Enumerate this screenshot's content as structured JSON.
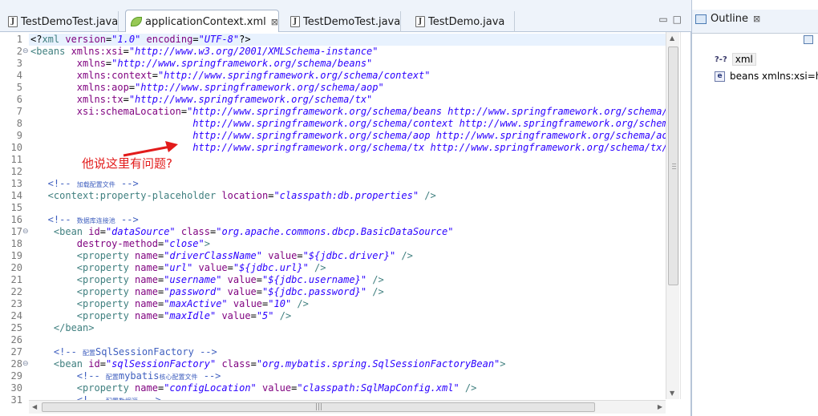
{
  "tabs": [
    {
      "label": "TestDemoTest.java",
      "icon": "java-file-icon",
      "active": false
    },
    {
      "label": "applicationContext.xml",
      "icon": "xml-file-icon",
      "active": true,
      "close": "⊠"
    },
    {
      "label": "TestDemoTest.java",
      "icon": "java-file-icon",
      "active": false
    },
    {
      "label": "TestDemo.java",
      "icon": "java-file-icon",
      "active": false
    }
  ],
  "line_numbers": [
    "1",
    "2",
    "3",
    "4",
    "5",
    "6",
    "7",
    "8",
    "9",
    "10",
    "11",
    "12",
    "13",
    "14",
    "15",
    "16",
    "17",
    "18",
    "19",
    "20",
    "21",
    "22",
    "23",
    "24",
    "25",
    "26",
    "27",
    "28",
    "29",
    "30",
    "31"
  ],
  "fold_markers": [
    {
      "line": 2,
      "symbol": "⊖"
    },
    {
      "line": 17,
      "symbol": "⊖"
    },
    {
      "line": 28,
      "symbol": "⊖"
    }
  ],
  "code": [
    [
      {
        "c": "t-pun",
        "t": "<?"
      },
      {
        "c": "t-tag",
        "t": "xml"
      },
      {
        "c": "t-att",
        "t": " version"
      },
      {
        "c": "t-pun",
        "t": "="
      },
      {
        "c": "t-val",
        "t": "\"1.0\""
      },
      {
        "c": "t-att",
        "t": " encoding"
      },
      {
        "c": "t-pun",
        "t": "="
      },
      {
        "c": "t-val",
        "t": "\"UTF-8\""
      },
      {
        "c": "t-pun",
        "t": "?>"
      }
    ],
    [
      {
        "c": "t-tag",
        "t": "<beans"
      },
      {
        "c": "t-att",
        "t": " xmlns:xsi"
      },
      {
        "c": "t-pun",
        "t": "="
      },
      {
        "c": "t-val",
        "t": "\"http://www.w3.org/2001/XMLSchema-instance\""
      }
    ],
    [
      {
        "c": "t-att",
        "t": "        xmlns"
      },
      {
        "c": "t-pun",
        "t": "="
      },
      {
        "c": "t-val",
        "t": "\"http://www.springframework.org/schema/beans\""
      }
    ],
    [
      {
        "c": "t-att",
        "t": "        xmlns:context"
      },
      {
        "c": "t-pun",
        "t": "="
      },
      {
        "c": "t-val",
        "t": "\"http://www.springframework.org/schema/context\""
      }
    ],
    [
      {
        "c": "t-att",
        "t": "        xmlns:aop"
      },
      {
        "c": "t-pun",
        "t": "="
      },
      {
        "c": "t-val",
        "t": "\"http://www.springframework.org/schema/aop\""
      }
    ],
    [
      {
        "c": "t-att",
        "t": "        xmlns:tx"
      },
      {
        "c": "t-pun",
        "t": "="
      },
      {
        "c": "t-val",
        "t": "\"http://www.springframework.org/schema/tx\""
      }
    ],
    [
      {
        "c": "t-att",
        "t": "        xsi:schemaLocation"
      },
      {
        "c": "t-pun",
        "t": "="
      },
      {
        "c": "t-val",
        "t": "\"http://www.springframework.org/schema/beans http://www.springframework.org/schema/bea"
      }
    ],
    [
      {
        "c": "t-val",
        "t": "                            http://www.springframework.org/schema/context http://www.springframework.org/schema/c"
      }
    ],
    [
      {
        "c": "t-val",
        "t": "                            http://www.springframework.org/schema/aop http://www.springframework.org/schema/aop/s"
      }
    ],
    [
      {
        "c": "t-val",
        "t": "                            http://www.springframework.org/schema/tx http://www.springframework.org/schema/tx/spr"
      }
    ],
    [],
    [],
    [
      {
        "c": "t-cmt",
        "t": "   <!-- "
      },
      {
        "c": "t-cmt t-small",
        "t": "加载配置文件"
      },
      {
        "c": "t-cmt",
        "t": " -->"
      }
    ],
    [
      {
        "c": "t-tag",
        "t": "   <context:property-placeholder"
      },
      {
        "c": "t-att",
        "t": " location"
      },
      {
        "c": "t-pun",
        "t": "="
      },
      {
        "c": "t-val",
        "t": "\"classpath:db.properties\""
      },
      {
        "c": "t-tag",
        "t": " />"
      }
    ],
    [],
    [
      {
        "c": "t-cmt",
        "t": "   <!-- "
      },
      {
        "c": "t-cmt t-small",
        "t": "数据库连接池"
      },
      {
        "c": "t-cmt",
        "t": " -->"
      }
    ],
    [
      {
        "c": "t-tag",
        "t": "    <bean"
      },
      {
        "c": "t-att",
        "t": " id"
      },
      {
        "c": "t-pun",
        "t": "="
      },
      {
        "c": "t-val",
        "t": "\"dataSource\""
      },
      {
        "c": "t-att",
        "t": " class"
      },
      {
        "c": "t-pun",
        "t": "="
      },
      {
        "c": "t-val",
        "t": "\"org.apache.commons.dbcp.BasicDataSource\""
      }
    ],
    [
      {
        "c": "t-att",
        "t": "        destroy-method"
      },
      {
        "c": "t-pun",
        "t": "="
      },
      {
        "c": "t-val",
        "t": "\"close\""
      },
      {
        "c": "t-tag",
        "t": ">"
      }
    ],
    [
      {
        "c": "t-tag",
        "t": "        <property"
      },
      {
        "c": "t-att",
        "t": " name"
      },
      {
        "c": "t-pun",
        "t": "="
      },
      {
        "c": "t-val",
        "t": "\"driverClassName\""
      },
      {
        "c": "t-att",
        "t": " value"
      },
      {
        "c": "t-pun",
        "t": "="
      },
      {
        "c": "t-val",
        "t": "\"${jdbc.driver}\""
      },
      {
        "c": "t-tag",
        "t": " />"
      }
    ],
    [
      {
        "c": "t-tag",
        "t": "        <property"
      },
      {
        "c": "t-att",
        "t": " name"
      },
      {
        "c": "t-pun",
        "t": "="
      },
      {
        "c": "t-val",
        "t": "\"url\""
      },
      {
        "c": "t-att",
        "t": " value"
      },
      {
        "c": "t-pun",
        "t": "="
      },
      {
        "c": "t-val",
        "t": "\"${jdbc.url}\""
      },
      {
        "c": "t-tag",
        "t": " />"
      }
    ],
    [
      {
        "c": "t-tag",
        "t": "        <property"
      },
      {
        "c": "t-att",
        "t": " name"
      },
      {
        "c": "t-pun",
        "t": "="
      },
      {
        "c": "t-val",
        "t": "\"username\""
      },
      {
        "c": "t-att",
        "t": " value"
      },
      {
        "c": "t-pun",
        "t": "="
      },
      {
        "c": "t-val",
        "t": "\"${jdbc.username}\""
      },
      {
        "c": "t-tag",
        "t": " />"
      }
    ],
    [
      {
        "c": "t-tag",
        "t": "        <property"
      },
      {
        "c": "t-att",
        "t": " name"
      },
      {
        "c": "t-pun",
        "t": "="
      },
      {
        "c": "t-val",
        "t": "\"password\""
      },
      {
        "c": "t-att",
        "t": " value"
      },
      {
        "c": "t-pun",
        "t": "="
      },
      {
        "c": "t-val",
        "t": "\"${jdbc.password}\""
      },
      {
        "c": "t-tag",
        "t": " />"
      }
    ],
    [
      {
        "c": "t-tag",
        "t": "        <property"
      },
      {
        "c": "t-att",
        "t": " name"
      },
      {
        "c": "t-pun",
        "t": "="
      },
      {
        "c": "t-val",
        "t": "\"maxActive\""
      },
      {
        "c": "t-att",
        "t": " value"
      },
      {
        "c": "t-pun",
        "t": "="
      },
      {
        "c": "t-val",
        "t": "\"10\""
      },
      {
        "c": "t-tag",
        "t": " />"
      }
    ],
    [
      {
        "c": "t-tag",
        "t": "        <property"
      },
      {
        "c": "t-att",
        "t": " name"
      },
      {
        "c": "t-pun",
        "t": "="
      },
      {
        "c": "t-val",
        "t": "\"maxIdle\""
      },
      {
        "c": "t-att",
        "t": " value"
      },
      {
        "c": "t-pun",
        "t": "="
      },
      {
        "c": "t-val",
        "t": "\"5\""
      },
      {
        "c": "t-tag",
        "t": " />"
      }
    ],
    [
      {
        "c": "t-tag",
        "t": "    </bean>"
      }
    ],
    [],
    [
      {
        "c": "t-cmt",
        "t": "    <!-- "
      },
      {
        "c": "t-cmt t-small",
        "t": "配置"
      },
      {
        "c": "t-cmt",
        "t": "SqlSessionFactory -->"
      }
    ],
    [
      {
        "c": "t-tag",
        "t": "    <bean"
      },
      {
        "c": "t-att",
        "t": " id"
      },
      {
        "c": "t-pun",
        "t": "="
      },
      {
        "c": "t-val",
        "t": "\"sqlSessionFactory\""
      },
      {
        "c": "t-att",
        "t": " class"
      },
      {
        "c": "t-pun",
        "t": "="
      },
      {
        "c": "t-val",
        "t": "\"org.mybatis.spring.SqlSessionFactoryBean\""
      },
      {
        "c": "t-tag",
        "t": ">"
      }
    ],
    [
      {
        "c": "t-cmt",
        "t": "        <!-- "
      },
      {
        "c": "t-cmt t-small",
        "t": "配置"
      },
      {
        "c": "t-cmt",
        "t": "mybatis"
      },
      {
        "c": "t-cmt t-small",
        "t": "核心配置文件"
      },
      {
        "c": "t-cmt",
        "t": " -->"
      }
    ],
    [
      {
        "c": "t-tag",
        "t": "        <property"
      },
      {
        "c": "t-att",
        "t": " name"
      },
      {
        "c": "t-pun",
        "t": "="
      },
      {
        "c": "t-val",
        "t": "\"configLocation\""
      },
      {
        "c": "t-att",
        "t": " value"
      },
      {
        "c": "t-pun",
        "t": "="
      },
      {
        "c": "t-val",
        "t": "\"classpath:SqlMapConfig.xml\""
      },
      {
        "c": "t-tag",
        "t": " />"
      }
    ],
    [
      {
        "c": "t-cmt",
        "t": "        <!-- "
      },
      {
        "c": "t-cmt t-small",
        "t": "配置数据源"
      },
      {
        "c": "t-cmt",
        "t": " -->"
      }
    ]
  ],
  "annotation": {
    "text": "他说这里有问题?",
    "color": "#e21b1b"
  },
  "outline": {
    "tab_label": "Outline",
    "close": "⊠",
    "items": [
      {
        "badge": "?-?",
        "label": "xml",
        "icon": "xml-declaration-icon",
        "selected": true
      },
      {
        "badge": "e",
        "label": "beans xmlns:xsi=ht",
        "icon": "element-icon",
        "selected": false
      }
    ]
  },
  "window_controls": {
    "minimize": "▭",
    "maximize": "□"
  },
  "colors": {
    "tag": "#3f7f7f",
    "attribute": "#7f007f",
    "value": "#2a00ff",
    "comment": "#3f5fbf",
    "current_line": "#e8f2fe"
  }
}
